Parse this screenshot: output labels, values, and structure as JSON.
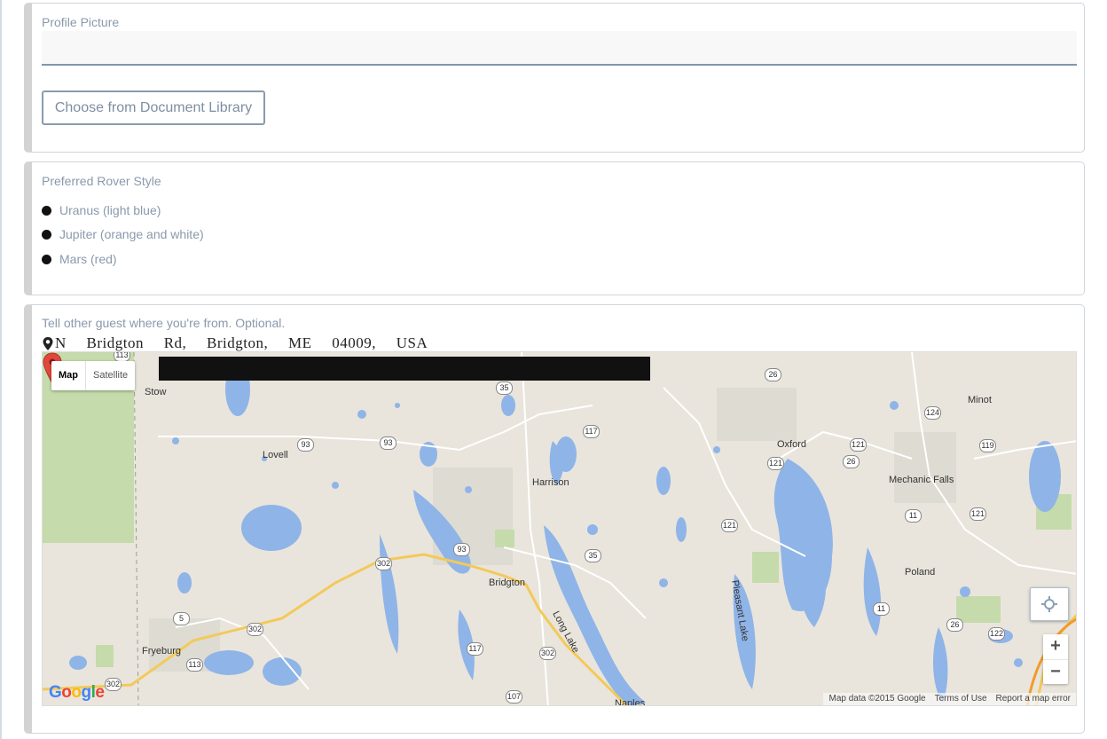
{
  "profile": {
    "label": "Profile Picture",
    "file_value": "",
    "doc_library_button": "Choose from Document Library"
  },
  "rover": {
    "label": "Preferred Rover Style",
    "options": [
      {
        "label": "Uranus (light blue)"
      },
      {
        "label": "Jupiter (orange and white)"
      },
      {
        "label": "Mars (red)"
      }
    ]
  },
  "location": {
    "label": "Tell other guest where you're from. Optional.",
    "address": "N Bridgton Rd, Bridgton, ME 04009, USA",
    "map": {
      "type_map": "Map",
      "type_satellite": "Satellite",
      "attribution": {
        "data": "Map data ©2015 Google",
        "terms": "Terms of Use",
        "report": "Report a map error"
      },
      "zoom_in": "+",
      "zoom_out": "−",
      "logo": "Google",
      "places": {
        "stow": "Stow",
        "lovell": "Lovell",
        "harrison": "Harrison",
        "bridgton": "Bridgton",
        "fryeburg": "Fryeburg",
        "oxford": "Oxford",
        "minot": "Minot",
        "mechanic_falls": "Mechanic Falls",
        "poland": "Poland",
        "long_lake": "Long Lake",
        "pleasant_lake": "Pleasant Lake",
        "naples": "Naples"
      },
      "routes": [
        "113",
        "35",
        "117",
        "93",
        "93",
        "26",
        "124",
        "121",
        "26",
        "119",
        "121",
        "11",
        "121",
        "121",
        "93",
        "35",
        "302",
        "5",
        "302",
        "113",
        "302",
        "117",
        "302",
        "107",
        "11",
        "26",
        "122"
      ],
      "colors": {
        "water": "#8fb4e8",
        "land": "#e9e5dc",
        "park": "#c5dbac",
        "highway": "#f3c95a",
        "pin": "#e2473c"
      }
    }
  }
}
